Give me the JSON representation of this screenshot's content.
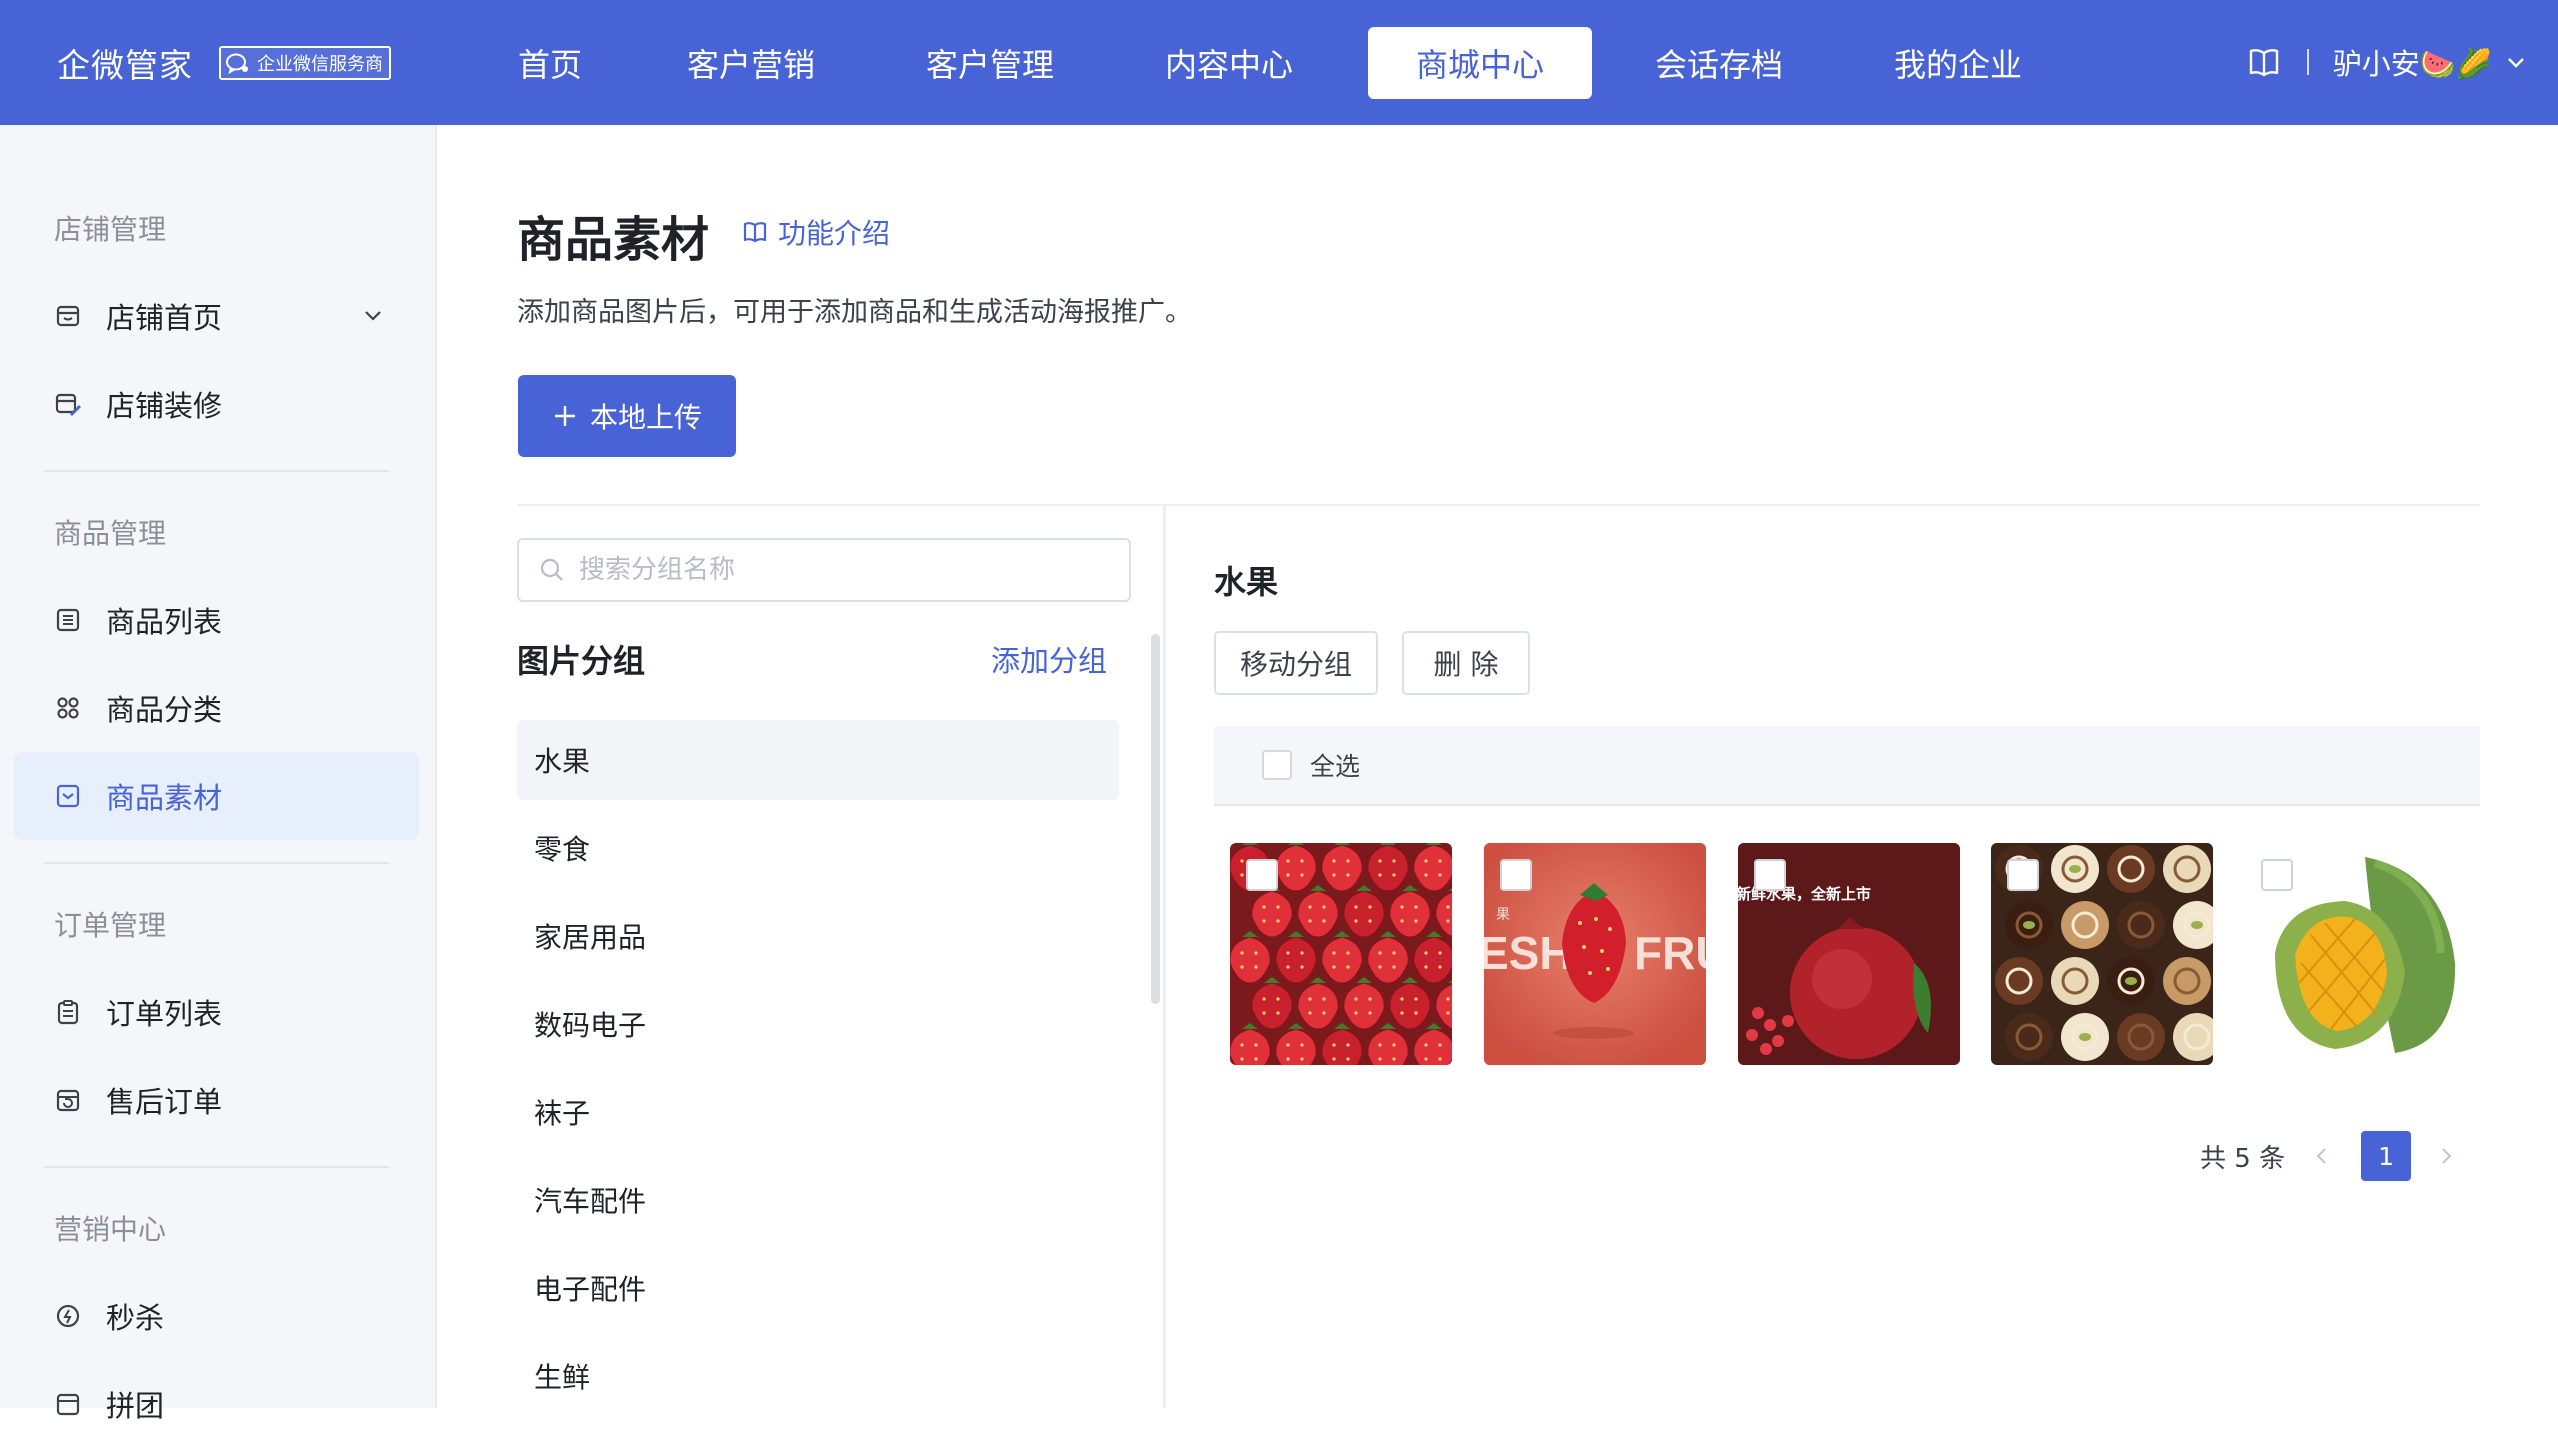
{
  "brand": {
    "name": "企微管家",
    "badge": "企业微信服务商"
  },
  "nav": {
    "items": [
      "首页",
      "客户营销",
      "客户管理",
      "内容中心",
      "商城中心",
      "会话存档",
      "我的企业"
    ],
    "active_index": 4
  },
  "header_right": {
    "user": "驴小安🍉🌽",
    "book_icon": "book-icon"
  },
  "sidebar": {
    "sections": [
      {
        "title": "店铺管理",
        "items": [
          {
            "label": "店铺首页",
            "icon": "store-icon",
            "expandable": true
          },
          {
            "label": "店铺装修",
            "icon": "store-decor-icon"
          }
        ]
      },
      {
        "title": "商品管理",
        "items": [
          {
            "label": "商品列表",
            "icon": "list-icon"
          },
          {
            "label": "商品分类",
            "icon": "category-icon"
          },
          {
            "label": "商品素材",
            "icon": "material-icon",
            "active": true
          }
        ]
      },
      {
        "title": "订单管理",
        "items": [
          {
            "label": "订单列表",
            "icon": "clipboard-icon"
          },
          {
            "label": "售后订单",
            "icon": "after-sale-icon"
          }
        ]
      },
      {
        "title": "营销中心",
        "items": [
          {
            "label": "秒杀",
            "icon": "flash-sale-icon"
          },
          {
            "label": "拼团",
            "icon": "group-buy-icon"
          }
        ]
      }
    ]
  },
  "page": {
    "title": "商品素材",
    "intro_link": "功能介绍",
    "description": "添加商品图片后，可用于添加商品和生成活动海报推广。",
    "upload_button": "本地上传"
  },
  "groups": {
    "search_placeholder": "搜索分组名称",
    "title": "图片分组",
    "add_label": "添加分组",
    "items": [
      "水果",
      "零食",
      "家居用品",
      "数码电子",
      "袜子",
      "汽车配件",
      "电子配件",
      "生鲜"
    ],
    "active_index": 0
  },
  "images_panel": {
    "folder_title": "水果",
    "move_button": "移动分组",
    "delete_button": "删 除",
    "select_all": "全选",
    "images": [
      {
        "subject": "strawberries"
      },
      {
        "subject": "strawberry-poster",
        "poster_text": "ESH",
        "poster_text2": "FRU",
        "poster_small": "果"
      },
      {
        "subject": "pomegranate",
        "banner": "新鲜水果，全新上市"
      },
      {
        "subject": "chocolates"
      },
      {
        "subject": "mango"
      }
    ],
    "pagination": {
      "total": "共 5 条",
      "current_page": "1"
    }
  },
  "colors": {
    "primary": "#4863d6",
    "sidebar_bg": "#f5f6fa",
    "active_bg": "#e7eefc"
  }
}
